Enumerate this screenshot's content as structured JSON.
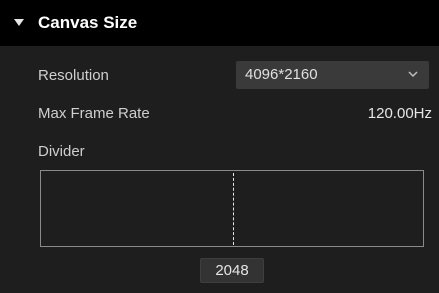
{
  "section": {
    "title": "Canvas Size"
  },
  "resolution": {
    "label": "Resolution",
    "selected": "4096*2160"
  },
  "max_frame_rate": {
    "label": "Max Frame Rate",
    "value": "120.00Hz"
  },
  "divider": {
    "label": "Divider",
    "position_value": "2048"
  }
}
